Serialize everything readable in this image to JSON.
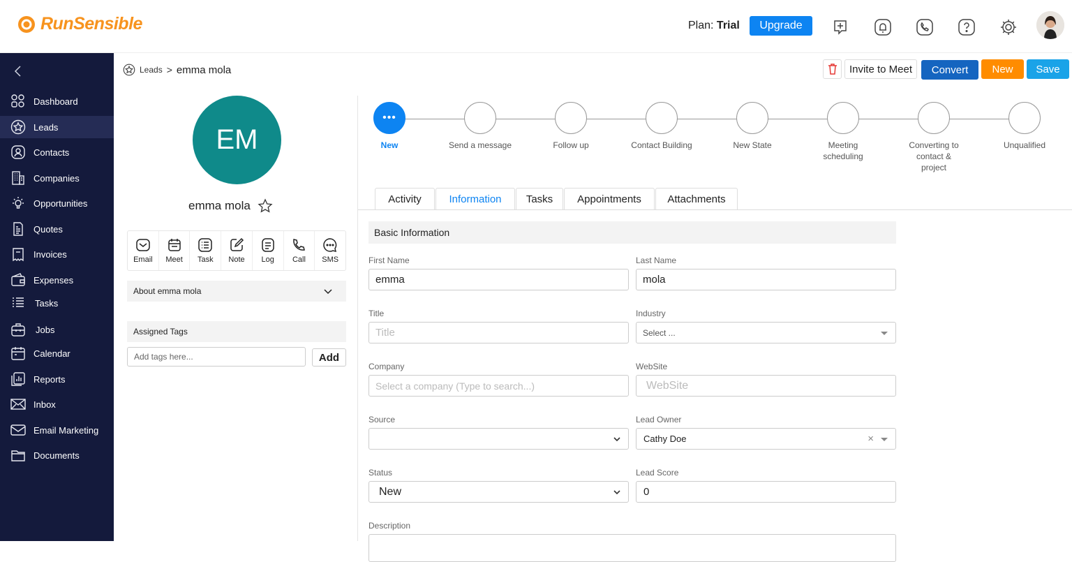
{
  "brand": {
    "name": "RunSensible",
    "color": "#f7931e"
  },
  "topbar": {
    "plan_label": "Plan:",
    "plan_value": "Trial",
    "upgrade_label": "Upgrade"
  },
  "sidebar": {
    "items": [
      {
        "label": "Dashboard",
        "icon": "grid-icon"
      },
      {
        "label": "Leads",
        "icon": "star-badge-icon",
        "active": true
      },
      {
        "label": "Contacts",
        "icon": "user-icon"
      },
      {
        "label": "Companies",
        "icon": "building-icon"
      },
      {
        "label": "Opportunities",
        "icon": "lightbulb-icon"
      },
      {
        "label": "Quotes",
        "icon": "quote-doc-icon"
      },
      {
        "label": "Invoices",
        "icon": "invoice-icon"
      },
      {
        "label": "Expenses",
        "icon": "wallet-icon"
      },
      {
        "label": "Tasks",
        "icon": "list-icon"
      },
      {
        "label": "Jobs",
        "icon": "briefcase-icon"
      },
      {
        "label": "Calendar",
        "icon": "calendar-icon"
      },
      {
        "label": "Reports",
        "icon": "report-icon"
      },
      {
        "label": "Inbox",
        "icon": "envelope-icon"
      },
      {
        "label": "Email Marketing",
        "icon": "email-marketing-icon"
      },
      {
        "label": "Documents",
        "icon": "folder-icon"
      }
    ]
  },
  "breadcrumb": {
    "parent": "Leads",
    "separator": ">",
    "current": "emma mola"
  },
  "actions": {
    "invite": "Invite to Meet",
    "convert": "Convert",
    "new": "New",
    "save": "Save"
  },
  "lead": {
    "initials": "EM",
    "name": "emma mola",
    "avatar_color": "#0f8a8a",
    "quick_actions": [
      {
        "label": "Email",
        "icon": "email-icon"
      },
      {
        "label": "Meet",
        "icon": "meet-icon"
      },
      {
        "label": "Task",
        "icon": "task-icon"
      },
      {
        "label": "Note",
        "icon": "note-icon"
      },
      {
        "label": "Log",
        "icon": "log-icon"
      },
      {
        "label": "Call",
        "icon": "phone-icon"
      },
      {
        "label": "SMS",
        "icon": "sms-icon"
      }
    ],
    "about_label": "About emma mola",
    "tags_label": "Assigned Tags",
    "tags_placeholder": "Add tags here...",
    "tags_add": "Add"
  },
  "stages": [
    {
      "label": "New",
      "active": true
    },
    {
      "label": "Send a message"
    },
    {
      "label": "Follow up"
    },
    {
      "label": "Contact Building"
    },
    {
      "label": "New State"
    },
    {
      "label": "Meeting scheduling"
    },
    {
      "label": "Converting to contact & project"
    },
    {
      "label": "Unqualified"
    }
  ],
  "tabs": [
    {
      "label": "Activity"
    },
    {
      "label": "Information",
      "active": true
    },
    {
      "label": "Tasks"
    },
    {
      "label": "Appointments"
    },
    {
      "label": "Attachments"
    }
  ],
  "form": {
    "section_title": "Basic Information",
    "first_name": {
      "label": "First Name",
      "value": "emma"
    },
    "last_name": {
      "label": "Last Name",
      "value": "mola"
    },
    "title": {
      "label": "Title",
      "placeholder": "Title"
    },
    "industry": {
      "label": "Industry",
      "placeholder": "Select ..."
    },
    "company": {
      "label": "Company",
      "placeholder": "Select a company (Type to search...)"
    },
    "website": {
      "label": "WebSite",
      "placeholder": "WebSite"
    },
    "source": {
      "label": "Source",
      "value": ""
    },
    "lead_owner": {
      "label": "Lead Owner",
      "value": "Cathy Doe",
      "clear": "×"
    },
    "status": {
      "label": "Status",
      "value": "New"
    },
    "lead_score": {
      "label": "Lead Score",
      "value": "0"
    },
    "description": {
      "label": "Description"
    }
  },
  "colors": {
    "primary": "#0d84f2",
    "convert": "#1565c0",
    "new": "#ff8c00",
    "save": "#1aa3e8",
    "sidebar": "#141a3c",
    "delete": "#e53935"
  }
}
